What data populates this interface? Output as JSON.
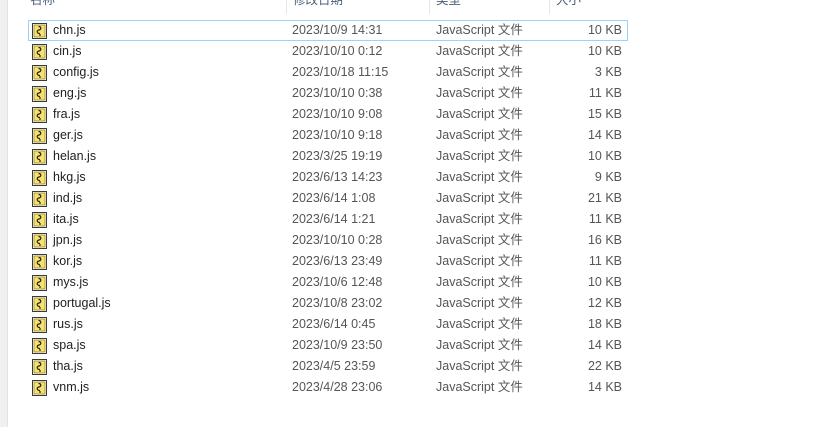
{
  "columns": {
    "name": "名称",
    "date": "修改日期",
    "type": "类型",
    "size": "大小"
  },
  "files": [
    {
      "name": "chn.js",
      "date": "2023/10/9 14:31",
      "type": "JavaScript 文件",
      "size": "10 KB"
    },
    {
      "name": "cin.js",
      "date": "2023/10/10 0:12",
      "type": "JavaScript 文件",
      "size": "10 KB"
    },
    {
      "name": "config.js",
      "date": "2023/10/18 11:15",
      "type": "JavaScript 文件",
      "size": "3 KB"
    },
    {
      "name": "eng.js",
      "date": "2023/10/10 0:38",
      "type": "JavaScript 文件",
      "size": "11 KB"
    },
    {
      "name": "fra.js",
      "date": "2023/10/10 9:08",
      "type": "JavaScript 文件",
      "size": "15 KB"
    },
    {
      "name": "ger.js",
      "date": "2023/10/10 9:18",
      "type": "JavaScript 文件",
      "size": "14 KB"
    },
    {
      "name": "helan.js",
      "date": "2023/3/25 19:19",
      "type": "JavaScript 文件",
      "size": "10 KB"
    },
    {
      "name": "hkg.js",
      "date": "2023/6/13 14:23",
      "type": "JavaScript 文件",
      "size": "9 KB"
    },
    {
      "name": "ind.js",
      "date": "2023/6/14 1:08",
      "type": "JavaScript 文件",
      "size": "21 KB"
    },
    {
      "name": "ita.js",
      "date": "2023/6/14 1:21",
      "type": "JavaScript 文件",
      "size": "11 KB"
    },
    {
      "name": "jpn.js",
      "date": "2023/10/10 0:28",
      "type": "JavaScript 文件",
      "size": "16 KB"
    },
    {
      "name": "kor.js",
      "date": "2023/6/13 23:49",
      "type": "JavaScript 文件",
      "size": "11 KB"
    },
    {
      "name": "mys.js",
      "date": "2023/10/6 12:48",
      "type": "JavaScript 文件",
      "size": "10 KB"
    },
    {
      "name": "portugal.js",
      "date": "2023/10/8 23:02",
      "type": "JavaScript 文件",
      "size": "12 KB"
    },
    {
      "name": "rus.js",
      "date": "2023/6/14 0:45",
      "type": "JavaScript 文件",
      "size": "18 KB"
    },
    {
      "name": "spa.js",
      "date": "2023/10/9 23:50",
      "type": "JavaScript 文件",
      "size": "14 KB"
    },
    {
      "name": "tha.js",
      "date": "2023/4/5 23:59",
      "type": "JavaScript 文件",
      "size": "22 KB"
    },
    {
      "name": "vnm.js",
      "date": "2023/4/28 23:06",
      "type": "JavaScript 文件",
      "size": "14 KB"
    }
  ],
  "file_icon": "javascript-file-icon",
  "colors": {
    "focus_border": "#99d1ff",
    "header_text": "#4c607a"
  }
}
